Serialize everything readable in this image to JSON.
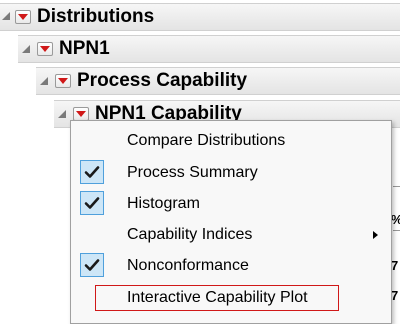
{
  "outline": {
    "items": [
      {
        "title": "Distributions"
      },
      {
        "title": "NPN1"
      },
      {
        "title": "Process Capability"
      },
      {
        "title": "NPN1 Capability"
      }
    ]
  },
  "context_menu": {
    "items": [
      {
        "label": "Compare Distributions",
        "checked": false,
        "submenu": false
      },
      {
        "label": "Process Summary",
        "checked": true,
        "submenu": false
      },
      {
        "label": "Histogram",
        "checked": true,
        "submenu": false
      },
      {
        "label": "Capability Indices",
        "checked": false,
        "submenu": true
      },
      {
        "label": "Nonconformance",
        "checked": true,
        "submenu": false
      },
      {
        "label": "Interactive Capability Plot",
        "checked": false,
        "submenu": false,
        "highlighted": true
      }
    ],
    "checkmark": "✔",
    "highlight_color": "#d01818",
    "check_bg": "#cde6f7",
    "check_border": "#4fa0dc"
  },
  "right_edge": {
    "glyphs": [
      "%",
      "7",
      "7"
    ]
  },
  "colors": {
    "hotspot_triangle": "#d01818",
    "header_gradient_top": "#f6f6f6",
    "header_gradient_bottom": "#e4e4e4"
  }
}
